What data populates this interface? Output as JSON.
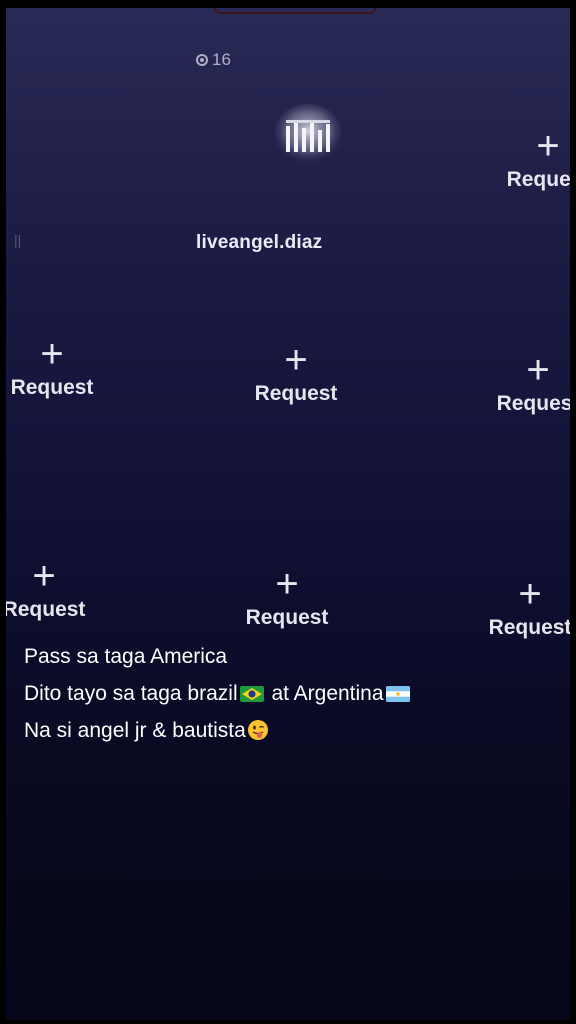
{
  "live": {
    "viewer_count": "16",
    "host_name": "liveangel.diaz",
    "request_label": "Request",
    "muted_marker": "||"
  },
  "caption": {
    "line1": "Pass sa taga America",
    "line2_a": "Dito tayo sa taga brazil",
    "line2_b": " at Argentina",
    "line3": "Na si angel jr & bautista"
  },
  "icons": {
    "viewer": "eye-icon",
    "plus": "plus-icon",
    "brazil_flag": "brazil-flag-icon",
    "argentina_flag": "argentina-flag-icon",
    "tongue_emoji": "winking-tongue-emoji-icon"
  },
  "colors": {
    "background_top": "#2a2a57",
    "background_bottom": "#06061a",
    "text": "#ffffff"
  }
}
